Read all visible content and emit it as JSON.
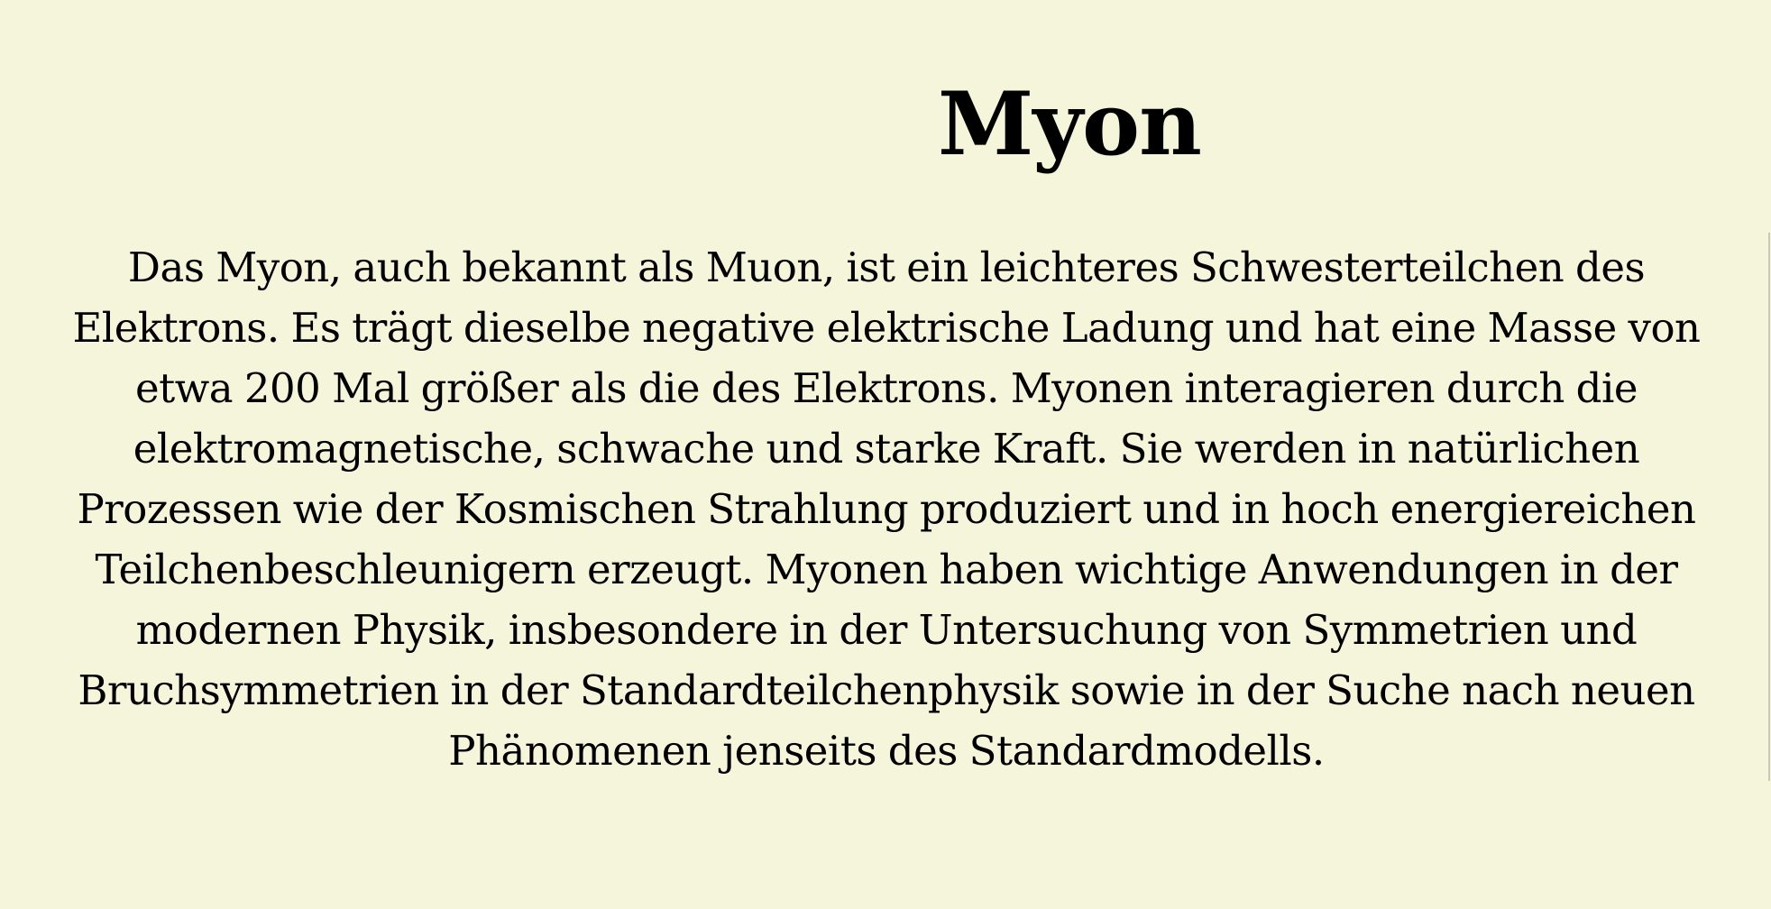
{
  "page": {
    "title": "Myon",
    "paragraph": "Das Myon, auch bekannt als Muon, ist ein leichteres Schwesterteilchen des Elektrons. Es trägt dieselbe negative elektrische Ladung und hat eine Masse von etwa 200 Mal größer als die des Elektrons. Myonen interagieren durch die elektromagnetische, schwache und starke Kraft. Sie werden in natürlichen Prozessen wie der Kosmischen Strahlung produziert und in hoch energiereichen Teilchenbeschleunigern erzeugt. Myonen haben wichtige Anwendungen in der modernen Physik, insbesondere in der Untersuchung von Symmetrien und Bruchsymmetrien in der Standardteilchenphysik sowie in der Suche nach neuen Phänomenen jenseits des Standardmodells."
  },
  "colors": {
    "background": "#f5f5dc",
    "text": "#000000"
  }
}
